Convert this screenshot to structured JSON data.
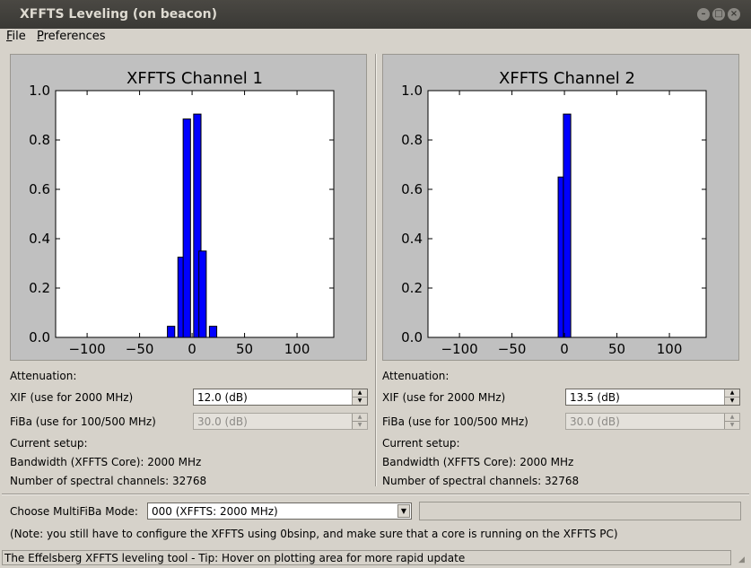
{
  "window": {
    "title": "XFFTS Leveling (on beacon)"
  },
  "menu": {
    "file": "File",
    "file_mnemonic": "F",
    "file_rest": "ile",
    "preferences": "Preferences",
    "pref_mnemonic": "P",
    "pref_rest": "references"
  },
  "channels": [
    {
      "title": "XFFTS Channel 1",
      "attenuation_label": "Attenuation:",
      "xif_label": "XIF (use for 2000 MHz)",
      "xif_value": "12.0 (dB)",
      "fiba_label": "FiBa (use for 100/500 MHz)",
      "fiba_value": "30.0 (dB)",
      "setup_label": "Current setup:",
      "bandwidth": "Bandwidth (XFFTS Core): 2000 MHz",
      "spectral_channels": "Number of spectral channels: 32768"
    },
    {
      "title": "XFFTS Channel 2",
      "attenuation_label": "Attenuation:",
      "xif_label": "XIF (use for 2000 MHz)",
      "xif_value": "13.5 (dB)",
      "fiba_label": "FiBa (use for 100/500 MHz)",
      "fiba_value": "30.0 (dB)",
      "setup_label": "Current setup:",
      "bandwidth": "Bandwidth (XFFTS Core): 2000 MHz",
      "spectral_channels": "Number of spectral channels: 32768"
    }
  ],
  "chart_data": [
    {
      "type": "bar",
      "title": "XFFTS Channel 1",
      "x": [
        -20,
        -10,
        -5,
        5,
        10,
        20
      ],
      "values": [
        0.045,
        0.325,
        0.885,
        0.905,
        0.35,
        0.045
      ],
      "xlim": [
        -130,
        135
      ],
      "ylim": [
        0.0,
        1.0
      ],
      "xticks": [
        -100,
        -50,
        0,
        50,
        100
      ],
      "yticks": [
        0.0,
        0.2,
        0.4,
        0.6,
        0.8,
        1.0
      ],
      "xtick_labels": [
        "−100",
        "−50",
        "0",
        "50",
        "100"
      ],
      "ytick_labels": [
        "0.0",
        "0.2",
        "0.4",
        "0.6",
        "0.8",
        "1.0"
      ],
      "bar_color": "#0000ff"
    },
    {
      "type": "bar",
      "title": "XFFTS Channel 2",
      "x": [
        -2.5,
        2.5
      ],
      "values": [
        0.65,
        0.905
      ],
      "xlim": [
        -130,
        135
      ],
      "ylim": [
        0.0,
        1.0
      ],
      "xticks": [
        -100,
        -50,
        0,
        50,
        100
      ],
      "yticks": [
        0.0,
        0.2,
        0.4,
        0.6,
        0.8,
        1.0
      ],
      "xtick_labels": [
        "−100",
        "−50",
        "0",
        "50",
        "100"
      ],
      "ytick_labels": [
        "0.0",
        "0.2",
        "0.4",
        "0.6",
        "0.8",
        "1.0"
      ],
      "bar_color": "#0000ff"
    }
  ],
  "mode": {
    "label": "Choose MultiFiBa Mode:",
    "selected": "000 (XFFTS: 2000 MHz)",
    "note": "(Note: you still have to configure the XFFTS using 0bsinp, and make sure that a core is running on the XFFTS PC)"
  },
  "status": {
    "text": "The Effelsberg XFFTS leveling tool - Tip: Hover on plotting area for more rapid update"
  }
}
